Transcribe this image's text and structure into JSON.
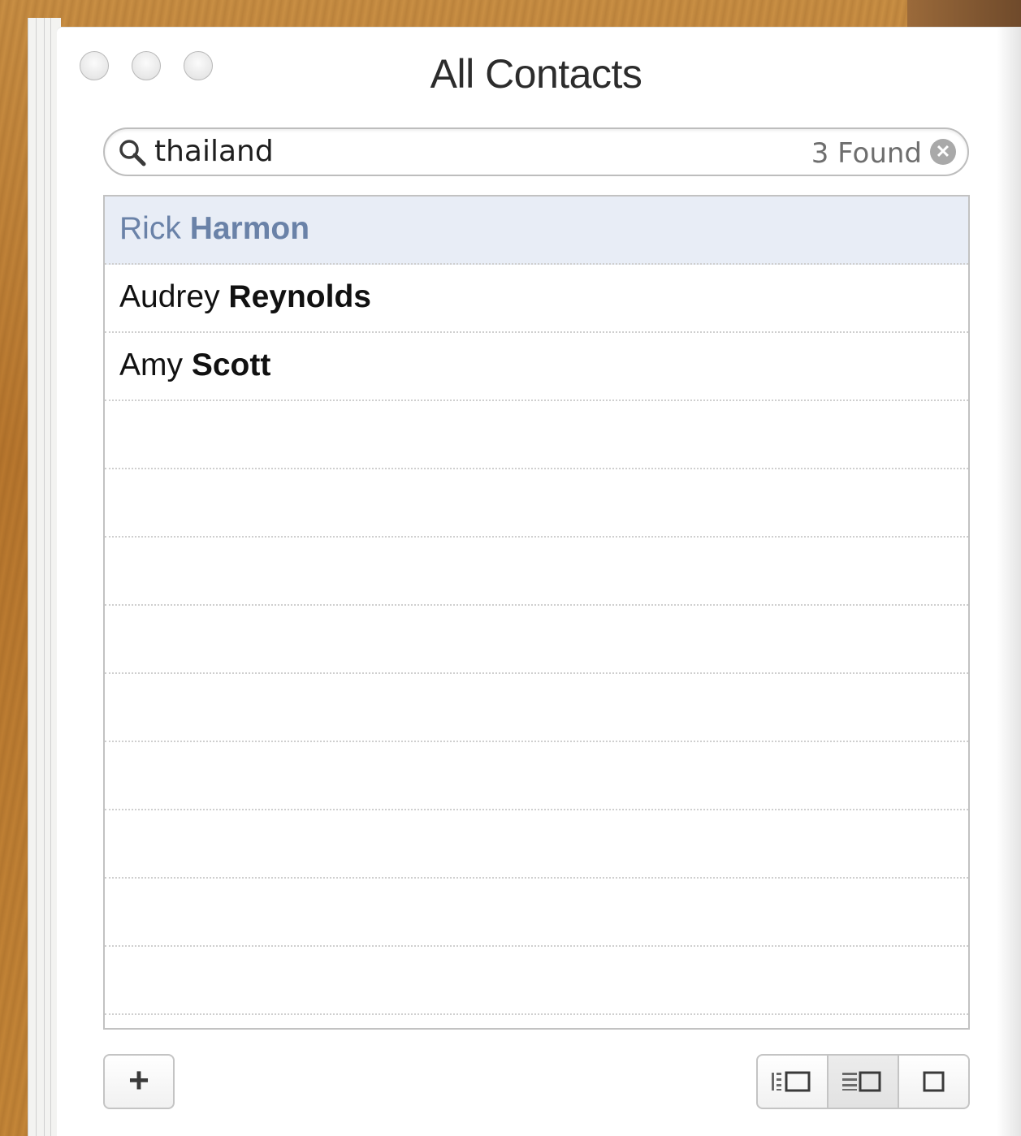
{
  "window": {
    "title": "All Contacts"
  },
  "search": {
    "value": "thailand",
    "result_count": "3 Found",
    "icon": "search-icon",
    "clear_icon": "clear-icon"
  },
  "contacts": [
    {
      "first": "Rick",
      "last": "Harmon",
      "selected": true
    },
    {
      "first": "Audrey",
      "last": "Reynolds",
      "selected": false
    },
    {
      "first": "Amy",
      "last": "Scott",
      "selected": false
    }
  ],
  "toolbar": {
    "add_label": "+",
    "view_modes": [
      {
        "icon": "groups-list-card-view-icon",
        "active": false
      },
      {
        "icon": "list-card-view-icon",
        "active": true
      },
      {
        "icon": "card-only-view-icon",
        "active": false
      }
    ]
  },
  "colors": {
    "selected_row_bg": "#e8edf6",
    "selected_text": "#6a82a8"
  }
}
